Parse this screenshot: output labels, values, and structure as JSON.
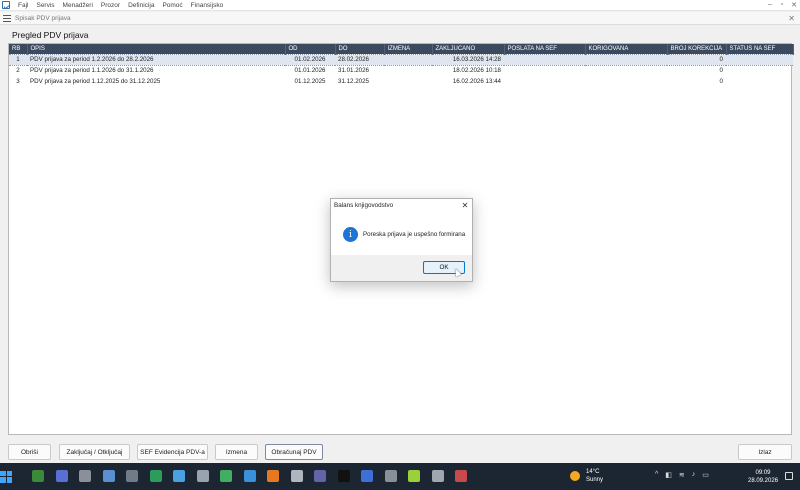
{
  "menu": {
    "items": [
      "Fajl",
      "Servis",
      "Menadžeri",
      "Prozor",
      "Definicija",
      "Pomoć",
      "Finansijsko"
    ],
    "controls": [
      "–",
      "▫",
      "✕"
    ]
  },
  "subwindow": {
    "title": "Spisak PDV prijava",
    "close": "✕"
  },
  "page": {
    "title": "Pregled PDV prijava"
  },
  "table": {
    "columns": [
      "RB",
      "OPIS",
      "OD",
      "DO",
      "IZMENA",
      "ZAKLJUCANO",
      "POSLATA NA SEF",
      "KORIGOVANA",
      "BROJ KOREKCIJA",
      "STATUS NA SEF"
    ],
    "rows": [
      {
        "rb": "1",
        "opis": "PDV prijava za period 1.2.2026 do 28.2.2026",
        "od": "01.02.2026",
        "do": "28.02.2026",
        "izmena": "",
        "zakljucano": "16.03.2026 14:28",
        "poslata": "",
        "korigovana": "",
        "broj": "0",
        "status": ""
      },
      {
        "rb": "2",
        "opis": "PDV prijava za period 1.1.2026 do 31.1.2026",
        "od": "01.01.2026",
        "do": "31.01.2026",
        "izmena": "",
        "zakljucano": "18.02.2026 10:18",
        "poslata": "",
        "korigovana": "",
        "broj": "0",
        "status": ""
      },
      {
        "rb": "3",
        "opis": "PDV prijava za period 1.12.2025 do 31.12.2025",
        "od": "01.12.2025",
        "do": "31.12.2025",
        "izmena": "",
        "zakljucano": "16.02.2026 13:44",
        "poslata": "",
        "korigovana": "",
        "broj": "0",
        "status": ""
      }
    ]
  },
  "buttons": {
    "obrisi": "Obriši",
    "zakljucaj": "Zaključaj / Otključaj",
    "sef": "SEF Evidencija PDV-a",
    "izmena": "Izmena",
    "obracunaj": "Obračunaj PDV",
    "izlaz": "Izlaz"
  },
  "dialog": {
    "title": "Balans knjigovodstvo",
    "close": "✕",
    "icon_glyph": "i",
    "message": "Poreska prijava je uspešno formirana",
    "ok": "OK"
  },
  "taskbar": {
    "weather_temp": "14°C",
    "weather_desc": "Sunny",
    "time": "09:09",
    "date": "28.09.2026",
    "tray_glyphs": [
      "^",
      "◧",
      "≋",
      "♪",
      "▭"
    ],
    "icons": [
      {
        "name": "excel-icon",
        "color": "#3a8a3a"
      },
      {
        "name": "save-icon",
        "color": "#5a6fd6"
      },
      {
        "name": "tools-icon",
        "color": "#8a8f99"
      },
      {
        "name": "database-icon",
        "color": "#5b8fd1"
      },
      {
        "name": "window-icon",
        "color": "#707a88"
      },
      {
        "name": "spreadsheet-icon",
        "color": "#2d9b5a"
      },
      {
        "name": "monitor-icon",
        "color": "#4aa0e0"
      },
      {
        "name": "settings-icon",
        "color": "#9aa3ad"
      },
      {
        "name": "chat-icon",
        "color": "#40b060"
      },
      {
        "name": "edit-icon",
        "color": "#3a90d9"
      },
      {
        "name": "browser-icon",
        "color": "#e8781f"
      },
      {
        "name": "wrench-icon",
        "color": "#b0b6bd"
      },
      {
        "name": "teams-icon",
        "color": "#6264a7"
      },
      {
        "name": "black-app-icon",
        "color": "#111111"
      },
      {
        "name": "document-icon",
        "color": "#3c6fd8"
      },
      {
        "name": "printer-icon",
        "color": "#888f99"
      },
      {
        "name": "leaf-icon",
        "color": "#9ad13a"
      },
      {
        "name": "tablet-icon",
        "color": "#a0a6ae"
      },
      {
        "name": "screen-icon",
        "color": "#c94a4a"
      }
    ]
  }
}
